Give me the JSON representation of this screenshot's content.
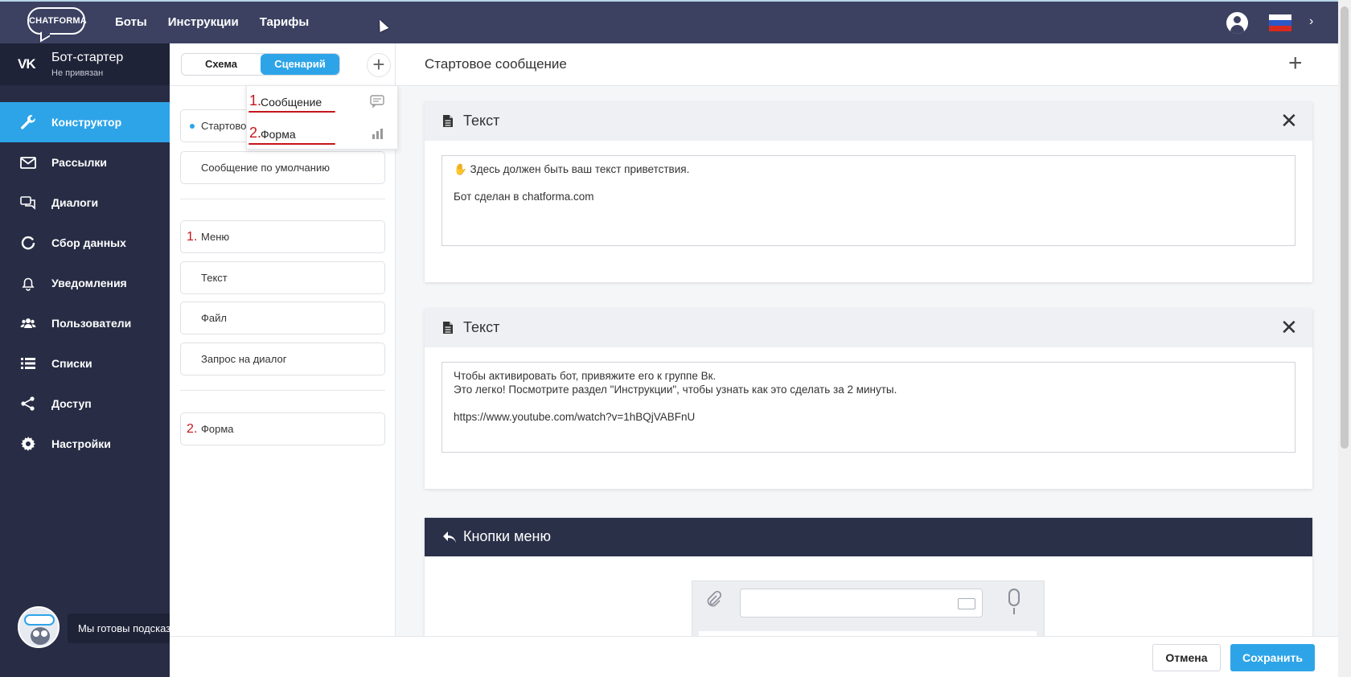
{
  "app": {
    "logo_text": "CHATFORMA",
    "nav": [
      "Боты",
      "Инструкции",
      "Тарифы"
    ],
    "flag_colors": [
      "#ffffff",
      "#2b57c7",
      "#d52b1e"
    ]
  },
  "sidebar": {
    "network_icon": "vk-icon",
    "bot_name": "Бот-стартер",
    "bot_status": "Не привязан",
    "items": [
      {
        "label": "Конструктор",
        "icon": "wrench-icon",
        "active": true
      },
      {
        "label": "Рассылки",
        "icon": "envelope-icon"
      },
      {
        "label": "Диалоги",
        "icon": "chat-icon"
      },
      {
        "label": "Сбор данных",
        "icon": "refresh-icon"
      },
      {
        "label": "Уведомления",
        "icon": "bell-icon"
      },
      {
        "label": "Пользователи",
        "icon": "users-icon"
      },
      {
        "label": "Списки",
        "icon": "list-icon"
      },
      {
        "label": "Доступ",
        "icon": "share-icon"
      },
      {
        "label": "Настройки",
        "icon": "gear-icon"
      }
    ],
    "helper_text": "Мы готовы подсказать!"
  },
  "scenario": {
    "tabs": [
      "Схема",
      "Сценарий"
    ],
    "active_tab": "Сценарий",
    "items": {
      "start": "Стартовое сообщение",
      "start_visible": "Стартово",
      "default": "Сообщение по умолчанию",
      "menu": "Меню",
      "text": "Текст",
      "file": "Файл",
      "dialog_request": "Запрос на диалог",
      "form": "Форма"
    },
    "annotations": {
      "one": "1.",
      "two": "2."
    }
  },
  "dropdown": {
    "items": [
      {
        "num": "1.",
        "label": "Сообщение",
        "icon": "comment-icon"
      },
      {
        "num": "2.",
        "label": "Форма",
        "icon": "bar-chart-icon"
      }
    ]
  },
  "content": {
    "title": "Стартовое сообщение",
    "blocks": [
      {
        "title": "Текст",
        "lines": [
          "✋ Здесь должен быть ваш текст приветствия.",
          "",
          "Бот сделан в chatforma.com"
        ]
      },
      {
        "title": "Текст",
        "lines": [
          "Чтобы активировать бот, привяжите его к группе Вк.",
          "Это легко! Посмотрите раздел \"Инструкции\", чтобы узнать как это сделать за 2 минуты.",
          "",
          "https://www.youtube.com/watch?v=1hBQjVABFnU"
        ]
      },
      {
        "title": "Кнопки меню"
      }
    ]
  },
  "footer": {
    "cancel": "Отмена",
    "save": "Сохранить"
  }
}
